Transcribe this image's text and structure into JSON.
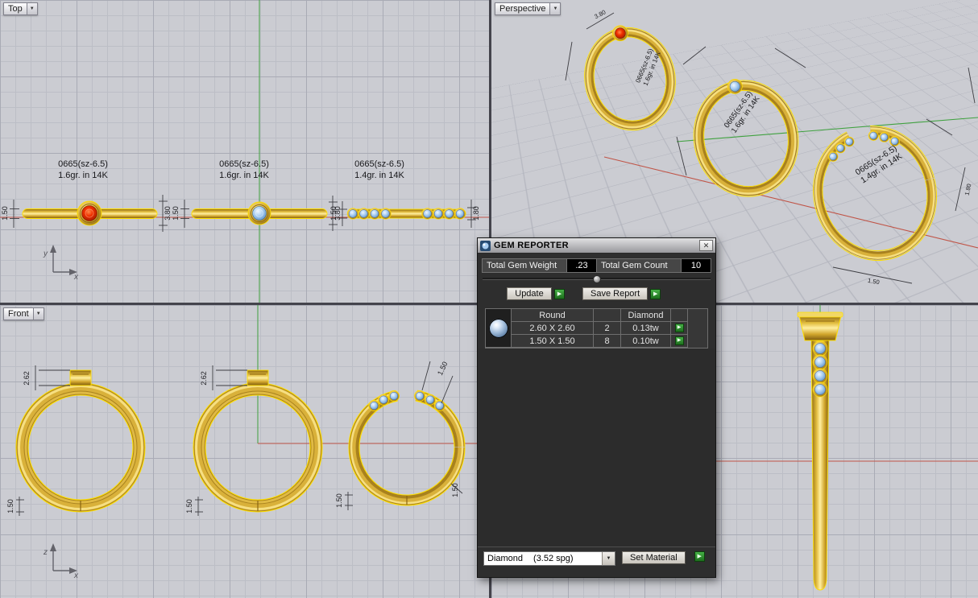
{
  "icons": {
    "dropdown_arrow": "▼",
    "play": "▶",
    "close": "✕"
  },
  "colors": {
    "gold": "#d4af37",
    "selection_highlight": "#ffdf00",
    "axis_green": "#3fa13f",
    "axis_red": "#c05548",
    "action_green": "#2f8f2f",
    "gem_blue": "#a8cdf0",
    "gem_red": "#f03000"
  },
  "viewports": {
    "top": {
      "label": "Top",
      "rings": [
        {
          "line1": "0665(sz-6.5)",
          "line2": "1.6gr.  in 14K"
        },
        {
          "line1": "0665(sz-6.5)",
          "line2": "1.6gr.  in 14K"
        },
        {
          "line1": "0665(sz-6.5)",
          "line2": "1.4gr.  in 14K"
        }
      ],
      "dims": {
        "band": "1.50",
        "head": "3.80",
        "accent_band": "1.80"
      },
      "axis": {
        "v": "y",
        "h": "x"
      }
    },
    "perspective": {
      "label": "Perspective",
      "ring_labels": [
        {
          "line1": "0665(sz-6.5)",
          "line2": "1.6gr.  in 14K"
        },
        {
          "line1": "0665(sz-6.5)",
          "line2": "1.6gr.  in 14K"
        },
        {
          "line1": "0665(sz-6.5)",
          "line2": "1.4gr.  in 14K"
        }
      ],
      "dims": {
        "head": "3.80",
        "accent_band": "1.80",
        "band": "1.50"
      }
    },
    "front": {
      "label": "Front",
      "dims": {
        "head_height": "2.62",
        "band": "1.50"
      },
      "axis": {
        "v": "z",
        "h": "x"
      }
    }
  },
  "gem_reporter": {
    "title": "GEM REPORTER",
    "totals": {
      "weight_label": "Total Gem Weight",
      "weight_value": ".23",
      "count_label": "Total Gem Count",
      "count_value": "10"
    },
    "buttons": {
      "update": "Update",
      "save_report": "Save Report",
      "set_material": "Set Material"
    },
    "table": {
      "shape_header": "Round",
      "material_header": "Diamond",
      "rows": [
        {
          "size": "2.60 X 2.60",
          "count": "2",
          "weight": "0.13tw"
        },
        {
          "size": "1.50 X 1.50",
          "count": "8",
          "weight": "0.10tw"
        }
      ]
    },
    "material": {
      "name": "Diamond",
      "spg": "(3.52 spg)"
    }
  }
}
